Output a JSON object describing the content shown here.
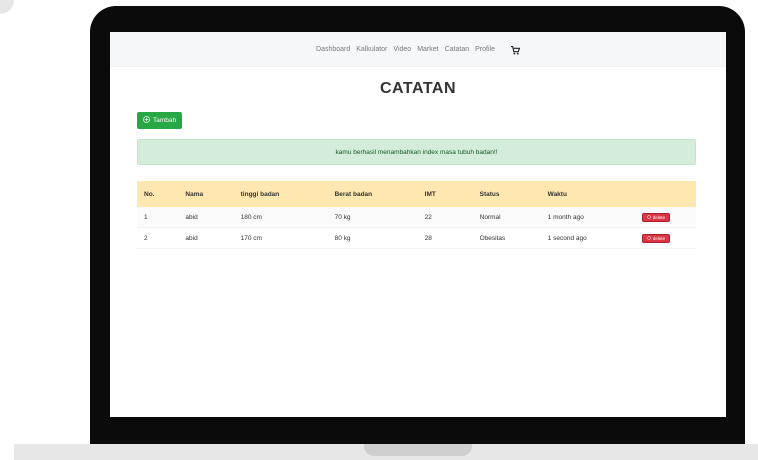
{
  "colors": {
    "accent": "#28a745",
    "danger": "#dc3545",
    "alert_bg": "#d4edda",
    "table_header_bg": "#ffe8b0"
  },
  "nav": {
    "items": [
      {
        "label": "Dashboard"
      },
      {
        "label": "Kalkulator"
      },
      {
        "label": "Video"
      },
      {
        "label": "Market"
      },
      {
        "label": "Catatan"
      },
      {
        "label": "Profile"
      }
    ],
    "cart_icon": "shopping-cart-icon"
  },
  "page": {
    "title": "CATATAN"
  },
  "actions": {
    "add_label": "Tambah",
    "add_icon": "plus-circle-icon"
  },
  "alert": {
    "message": "kamu berhasil menambahkan index masa tubuh badan!!"
  },
  "table": {
    "headers": [
      "No.",
      "Nama",
      "tinggi badan",
      "Berat badan",
      "IMT",
      "Status",
      "Waktu",
      ""
    ],
    "rows": [
      {
        "no": "1",
        "nama": "abid",
        "tinggi": "180 cm",
        "berat": "70 kg",
        "imt": "22",
        "status": "Normal",
        "waktu": "1 month ago",
        "delete_label": "delete"
      },
      {
        "no": "2",
        "nama": "abid",
        "tinggi": "170 cm",
        "berat": "80 kg",
        "imt": "28",
        "status": "Obesitas",
        "waktu": "1 second ago",
        "delete_label": "delete"
      }
    ]
  }
}
